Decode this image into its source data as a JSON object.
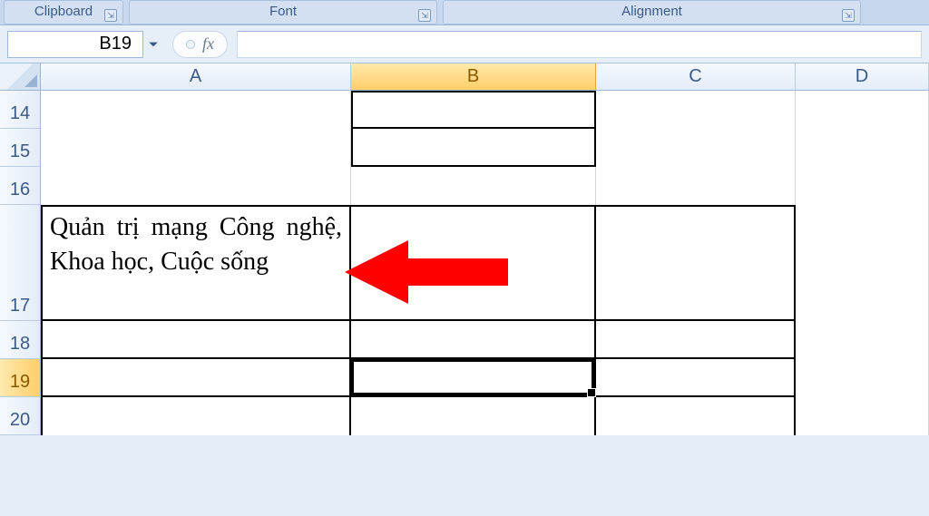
{
  "ribbon": {
    "groups": {
      "clipboard": "Clipboard",
      "font": "Font",
      "alignment": "Alignment"
    }
  },
  "namebox": {
    "value": "B19"
  },
  "formula_bar": {
    "fx_label": "fx",
    "value": ""
  },
  "columns": [
    "A",
    "B",
    "C",
    "D"
  ],
  "rows_visible": [
    "14",
    "15",
    "16",
    "17",
    "18",
    "19",
    "20"
  ],
  "active_column": "B",
  "active_row": "19",
  "cells": {
    "A17": "Quản trị mạng Công nghệ, Khoa học, Cuộc sống"
  },
  "annotation": {
    "type": "arrow-left",
    "color": "#ff0000"
  }
}
